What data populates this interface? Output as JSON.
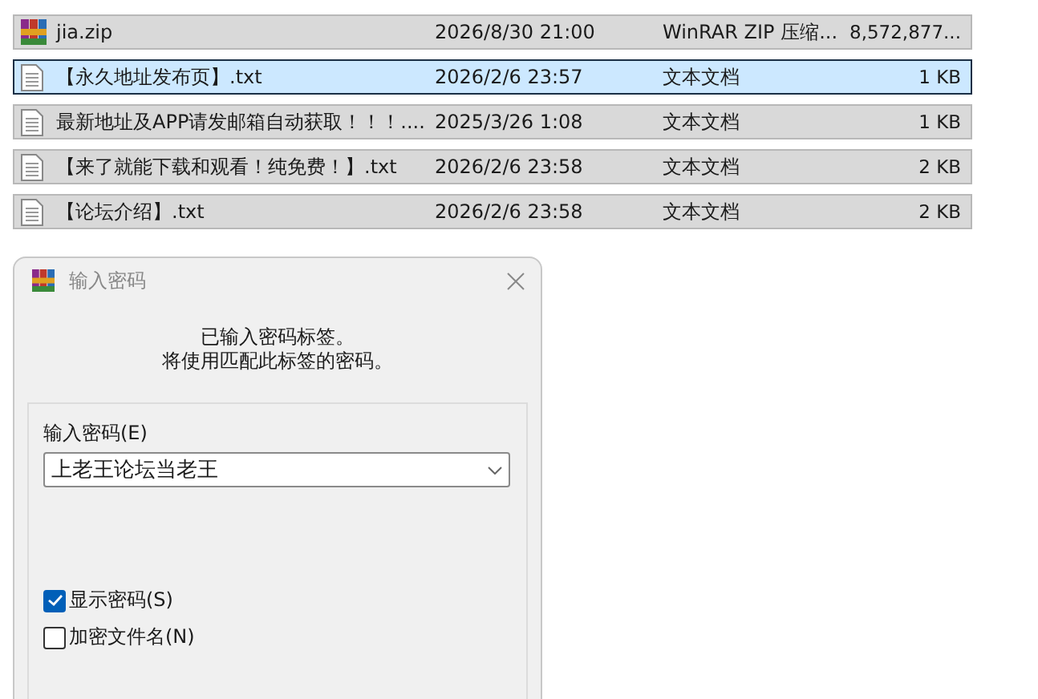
{
  "files": [
    {
      "kind": "archive",
      "name": "jia.zip",
      "modified": "2026/8/30 21:00",
      "type": "WinRAR ZIP 压缩...",
      "size": "8,572,877...",
      "selected": false
    },
    {
      "kind": "text",
      "name": "【永久地址发布页】.txt",
      "modified": "2026/2/6 23:57",
      "type": "文本文档",
      "size": "1 KB",
      "selected": true
    },
    {
      "kind": "text",
      "name": "最新地址及APP请发邮箱自动获取！！！....",
      "modified": "2025/3/26 1:08",
      "type": "文本文档",
      "size": "1 KB",
      "selected": false
    },
    {
      "kind": "text",
      "name": "【来了就能下载和观看！纯免费！】.txt",
      "modified": "2026/2/6 23:58",
      "type": "文本文档",
      "size": "2 KB",
      "selected": false
    },
    {
      "kind": "text",
      "name": "【论坛介绍】.txt",
      "modified": "2026/2/6 23:58",
      "type": "文本文档",
      "size": "2 KB",
      "selected": false
    }
  ],
  "dialog": {
    "title": "输入密码",
    "message": [
      "已输入密码标签。",
      "将使用匹配此标签的密码。"
    ],
    "password_label": "输入密码(E)",
    "password_value": "上老王论坛当老王",
    "options": [
      {
        "label": "显示密码(S)",
        "checked": true
      },
      {
        "label": "加密文件名(N)",
        "checked": false
      }
    ]
  }
}
